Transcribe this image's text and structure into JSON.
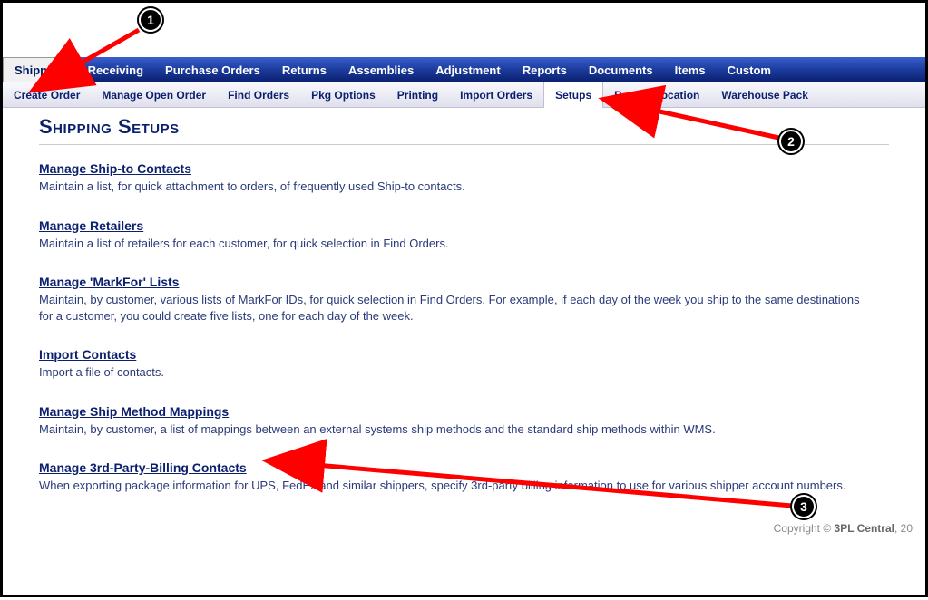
{
  "mainNav": {
    "items": [
      {
        "label": "Shipping",
        "active": true
      },
      {
        "label": "Receiving"
      },
      {
        "label": "Purchase Orders"
      },
      {
        "label": "Returns"
      },
      {
        "label": "Assemblies"
      },
      {
        "label": "Adjustment"
      },
      {
        "label": "Reports"
      },
      {
        "label": "Documents"
      },
      {
        "label": "Items"
      },
      {
        "label": "Custom"
      }
    ]
  },
  "subNav": {
    "items": [
      {
        "label": "Create Order"
      },
      {
        "label": "Manage Open Order"
      },
      {
        "label": "Find Orders"
      },
      {
        "label": "Pkg Options"
      },
      {
        "label": "Printing"
      },
      {
        "label": "Import Orders"
      },
      {
        "label": "Setups",
        "active": true
      },
      {
        "label": "Batch Allocation"
      },
      {
        "label": "Warehouse Pack"
      }
    ]
  },
  "page": {
    "title": "Shipping Setups"
  },
  "sections": [
    {
      "link": "Manage Ship-to Contacts",
      "desc": "Maintain a list, for quick attachment to orders, of frequently used Ship-to contacts."
    },
    {
      "link": "Manage Retailers",
      "desc": "Maintain a list of retailers for each customer, for quick selection in Find Orders."
    },
    {
      "link": "Manage 'MarkFor' Lists",
      "desc": "Maintain, by customer, various lists of MarkFor IDs, for quick selection in Find Orders. For example, if each day of the week you ship to the same destinations for a customer, you could create five lists, one for each day of the week."
    },
    {
      "link": "Import Contacts",
      "desc": "Import a file of contacts."
    },
    {
      "link": "Manage Ship Method Mappings",
      "desc": "Maintain, by customer, a list of mappings between an external systems ship methods and the standard ship methods within WMS."
    },
    {
      "link": "Manage 3rd-Party-Billing Contacts",
      "desc": "When exporting package information for UPS, FedEx and similar shippers, specify 3rd-party billing information to use for various shipper account numbers."
    }
  ],
  "footer": {
    "prefix": "Copyright © ",
    "brand": "3PL Central",
    "suffix": ", 20"
  },
  "annotations": {
    "markers": [
      "1",
      "2",
      "3"
    ]
  }
}
